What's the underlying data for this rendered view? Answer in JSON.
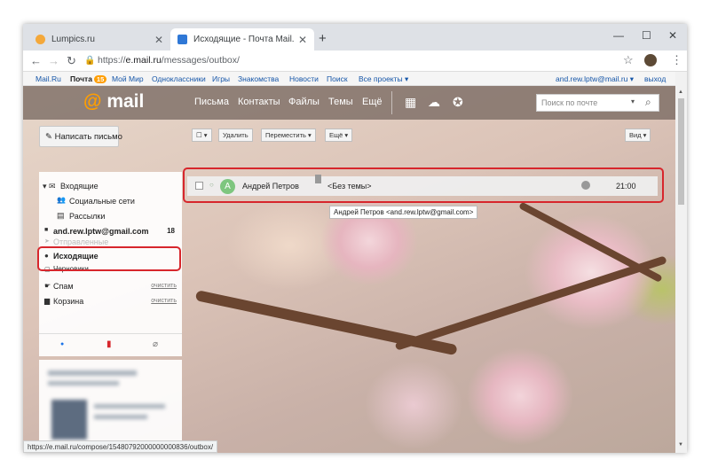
{
  "browser": {
    "tabs": [
      {
        "title": "Lumpics.ru",
        "favicon_color": "#f4a83a"
      },
      {
        "title": "Исходящие - Почта Mail.Ru",
        "favicon_color": "#2f78d6"
      }
    ],
    "new_tab": "+",
    "window_controls": {
      "minimize": "—",
      "maximize": "☐",
      "close": "✕"
    },
    "url_prefix": "https://",
    "url_host": "e.mail.ru",
    "url_path": "/messages/outbox/"
  },
  "portal": {
    "links": [
      "Mail.Ru",
      "Почта",
      "Мой Мир",
      "Одноклассники",
      "Игры",
      "Знакомства",
      "Новости",
      "Поиск",
      "Все проекты ▾"
    ],
    "mail_badge": "15",
    "account": "and.rew.lptw@mail.ru ▾",
    "logout": "выход"
  },
  "header": {
    "logo_at": "@",
    "logo_text": "mail",
    "nav": [
      "Письма",
      "Контакты",
      "Файлы",
      "Темы",
      "Ещё"
    ],
    "search_placeholder": "Поиск по почте",
    "search_dropdown": "▾",
    "search_icon": "⌕"
  },
  "sidebar": {
    "compose": "Написать письмо",
    "folders": [
      {
        "label": "Входящие",
        "icon": "envelope-icon",
        "glyph": "▾ ✉"
      },
      {
        "label": "Социальные сети",
        "icon": "people-icon",
        "glyph": "👥"
      },
      {
        "label": "Рассылки",
        "icon": "newsletter-icon",
        "glyph": "▤"
      },
      {
        "label": "and.rew.lptw@gmail.com",
        "icon": "folder-icon",
        "glyph": "■",
        "count": "18"
      },
      {
        "label": "Отправленные",
        "icon": "sent-icon",
        "glyph": "➤"
      },
      {
        "label": "Исходящие",
        "icon": "outbox-icon",
        "glyph": "●"
      },
      {
        "label": "Черновики",
        "icon": "drafts-icon",
        "glyph": "▢"
      },
      {
        "label": "Спам",
        "icon": "spam-icon",
        "glyph": "☛",
        "action": "очистить"
      },
      {
        "label": "Корзина",
        "icon": "trash-icon",
        "glyph": "▆",
        "action": "очистить"
      }
    ],
    "bottom_icons": {
      "dot": "●",
      "bookmark": "▮",
      "clip": "⌀"
    }
  },
  "toolbar": {
    "select": "☐ ▾",
    "delete": "Удалить",
    "move": "Переместить ▾",
    "more": "Ещё ▾",
    "view": "Вид ▾"
  },
  "message": {
    "avatar": "A",
    "sender": "Андрей Петров",
    "subject": "<Без темы>",
    "time": "21:00",
    "tooltip": "Андрей Петров <and.rew.lptw@gmail.com>"
  },
  "status_url": "https://e.mail.ru/compose/15480792000000000836/outbox/",
  "colors": {
    "highlight": "#d7262c",
    "accent": "#ff9e00",
    "link": "#1656a8"
  }
}
